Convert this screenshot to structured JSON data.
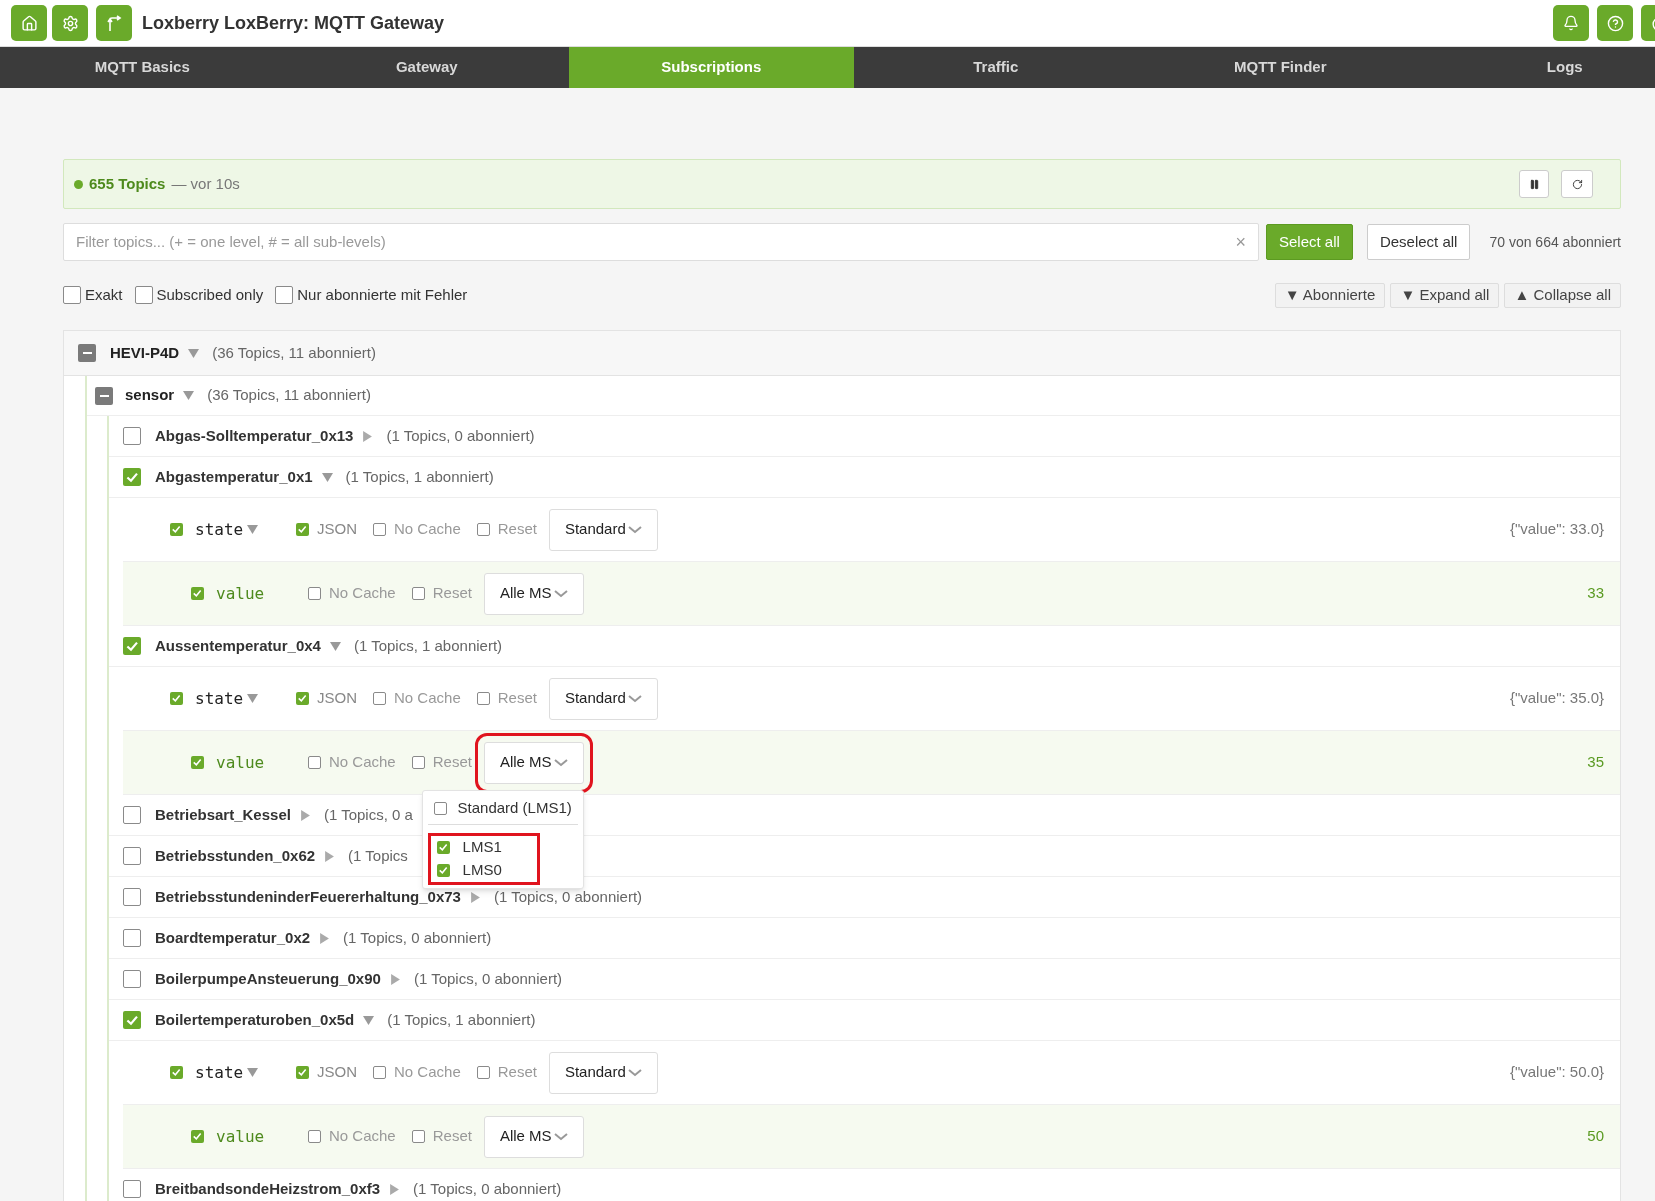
{
  "header": {
    "title": "Loxberry LoxBerry: MQTT Gateway"
  },
  "nav": [
    {
      "label": "MQTT Basics",
      "selected": false
    },
    {
      "label": "Gateway",
      "selected": false
    },
    {
      "label": "Subscriptions",
      "selected": true
    },
    {
      "label": "Traffic",
      "selected": false
    },
    {
      "label": "MQTT Finder",
      "selected": false
    },
    {
      "label": "Logs",
      "selected": false
    }
  ],
  "status": {
    "live": true,
    "count": "655 Topics",
    "age": "— vor 10s"
  },
  "filter": {
    "placeholder": "Filter topics... (+ = one level, # = all sub-levels)",
    "clear": "×",
    "select_all": "Select all",
    "deselect_all": "Deselect all",
    "count": "70 von 664 abonniert"
  },
  "options": [
    {
      "label": "Exakt",
      "checked": false
    },
    {
      "label": "Subscribed only",
      "checked": false
    },
    {
      "label": "Nur abonnierte mit Fehler",
      "checked": false
    }
  ],
  "actions": [
    "▼ Abonnierte",
    "▼ Expand all",
    "▲ Collapse all"
  ],
  "tree": {
    "name": "HEVI-P4D",
    "indeterminate": true,
    "expanded": true,
    "summary": "(36 Topics, 11 abonniert)",
    "children": [
      {
        "name": "sensor",
        "indeterminate": true,
        "expanded": true,
        "summary": "(36 Topics, 11 abonniert)",
        "children": [
          {
            "name": "Abgas-Solltemperatur_0x13",
            "checked": false,
            "expanded": false,
            "summary": "(1 Topics, 0 abonniert)"
          },
          {
            "name": "Abgastemperatur_0x1",
            "checked": true,
            "expanded": true,
            "summary": "(1 Topics, 1 abonniert)",
            "fields": [
              {
                "kind": "state",
                "name": "state",
                "checked": true,
                "expanded": true,
                "options": [
                  {
                    "label": "JSON",
                    "checked": true
                  },
                  {
                    "label": "No Cache",
                    "checked": false
                  },
                  {
                    "label": "Reset",
                    "checked": false
                  }
                ],
                "target": "Standard",
                "highlighted": false,
                "payload": "{\"value\": 33.0}"
              },
              {
                "kind": "value",
                "name": "value",
                "checked": true,
                "options": [
                  {
                    "label": "No Cache",
                    "checked": false
                  },
                  {
                    "label": "Reset",
                    "checked": false
                  }
                ],
                "target": "Alle MS",
                "highlighted": false,
                "payload": "33"
              }
            ]
          },
          {
            "name": "Aussentemperatur_0x4",
            "checked": true,
            "expanded": true,
            "summary": "(1 Topics, 1 abonniert)",
            "fields": [
              {
                "kind": "state",
                "name": "state",
                "checked": true,
                "expanded": true,
                "options": [
                  {
                    "label": "JSON",
                    "checked": true
                  },
                  {
                    "label": "No Cache",
                    "checked": false
                  },
                  {
                    "label": "Reset",
                    "checked": false
                  }
                ],
                "target": "Standard",
                "highlighted": false,
                "payload": "{\"value\": 35.0}"
              },
              {
                "kind": "value",
                "name": "value",
                "checked": true,
                "options": [
                  {
                    "label": "No Cache",
                    "checked": false
                  },
                  {
                    "label": "Reset",
                    "checked": false
                  }
                ],
                "target": "Alle MS",
                "highlighted": true,
                "payload": "35",
                "menu": [
                  {
                    "label": "Standard (LMS1)",
                    "checked": false,
                    "highlighted": false
                  },
                  {
                    "label": "LMS1",
                    "checked": true,
                    "highlighted": true
                  },
                  {
                    "label": "LMS0",
                    "checked": true,
                    "highlighted": true
                  }
                ]
              }
            ]
          },
          {
            "name": "Betriebsart_Kessel",
            "checked": false,
            "expanded": false,
            "summary": "(1 Topics, 0 a"
          },
          {
            "name": "Betriebsstunden_0x62",
            "checked": false,
            "expanded": false,
            "summary": "(1 Topics"
          },
          {
            "name": "BetriebsstundeninderFeuererhaltung_0x73",
            "checked": false,
            "expanded": false,
            "summary": "(1 Topics, 0 abonniert)"
          },
          {
            "name": "Boardtemperatur_0x2",
            "checked": false,
            "expanded": false,
            "summary": "(1 Topics, 0 abonniert)"
          },
          {
            "name": "BoilerpumpeAnsteuerung_0x90",
            "checked": false,
            "expanded": false,
            "summary": "(1 Topics, 0 abonniert)"
          },
          {
            "name": "Boilertemperaturoben_0x5d",
            "checked": true,
            "expanded": true,
            "summary": "(1 Topics, 1 abonniert)",
            "fields": [
              {
                "kind": "state",
                "name": "state",
                "checked": true,
                "expanded": true,
                "options": [
                  {
                    "label": "JSON",
                    "checked": true
                  },
                  {
                    "label": "No Cache",
                    "checked": false
                  },
                  {
                    "label": "Reset",
                    "checked": false
                  }
                ],
                "target": "Standard",
                "highlighted": false,
                "payload": "{\"value\": 50.0}"
              },
              {
                "kind": "value",
                "name": "value",
                "checked": true,
                "options": [
                  {
                    "label": "No Cache",
                    "checked": false
                  },
                  {
                    "label": "Reset",
                    "checked": false
                  }
                ],
                "target": "Alle MS",
                "highlighted": false,
                "payload": "50"
              }
            ]
          },
          {
            "name": "BreitbandsondeHeizstrom_0xf3",
            "checked": false,
            "expanded": false,
            "summary": "(1 Topics, 0 abonniert)"
          }
        ]
      }
    ]
  }
}
